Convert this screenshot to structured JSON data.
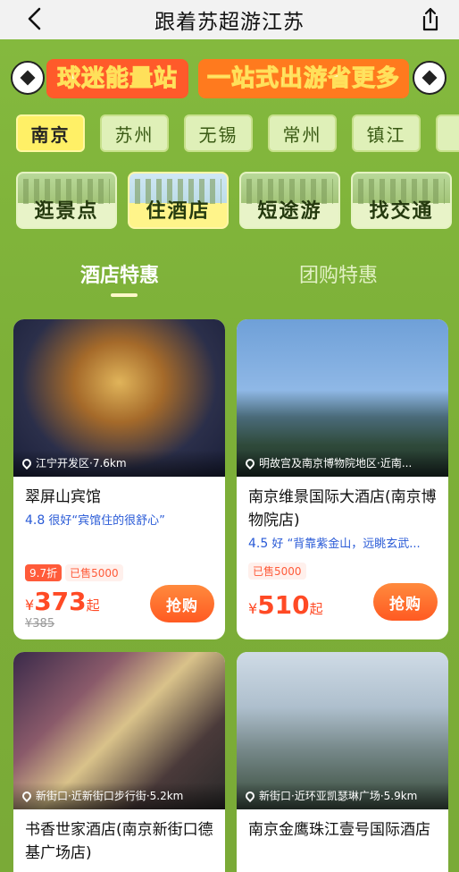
{
  "header": {
    "title": "跟着苏超游江苏"
  },
  "banner": {
    "left_text": "球迷能量站",
    "right_text": "一站式出游省更多"
  },
  "cities": [
    "南京",
    "苏州",
    "无锡",
    "常州",
    "镇江",
    "扬"
  ],
  "active_city_index": 0,
  "categories": [
    "逛景点",
    "住酒店",
    "短途游",
    "找交通"
  ],
  "active_category_index": 1,
  "tabs": [
    "酒店特惠",
    "团购特惠"
  ],
  "active_tab_index": 0,
  "hotels": [
    {
      "location": "江宁开发区·7.6km",
      "name": "翠屏山宾馆",
      "score": "4.8",
      "rating_word": "很好",
      "review": "“宾馆住的很舒心”",
      "discount": "9.7折",
      "sold": "已售5000",
      "currency": "¥",
      "price": "373",
      "price_suffix": "起",
      "original_price": "¥385",
      "buy_label": "抢购"
    },
    {
      "location": "明故宫及南京博物院地区·近南...",
      "name": "南京维景国际大酒店(南京博物院店)",
      "score": "4.5",
      "rating_word": "好",
      "review": "“背靠紫金山，远眺玄武...",
      "discount": "",
      "sold": "已售5000",
      "currency": "¥",
      "price": "510",
      "price_suffix": "起",
      "original_price": "",
      "buy_label": "抢购"
    },
    {
      "location": "新街口·近新街口步行街·5.2km",
      "name": "书香世家酒店(南京新街口德基广场店)",
      "score": "",
      "rating_word": "",
      "review": "",
      "discount": "",
      "sold": "",
      "currency": "",
      "price": "",
      "price_suffix": "",
      "original_price": "",
      "buy_label": ""
    },
    {
      "location": "新街口·近环亚凯瑟琳广场·5.9km",
      "name": "南京金鹰珠江壹号国际酒店",
      "score": "",
      "rating_word": "",
      "review": "",
      "discount": "",
      "sold": "",
      "currency": "",
      "price": "",
      "price_suffix": "",
      "original_price": "",
      "buy_label": ""
    }
  ],
  "colors": {
    "bg": "#7fb23a",
    "accent": "#ff5a22",
    "active_city": "#fff066",
    "rating_blue": "#2a5bd7"
  }
}
